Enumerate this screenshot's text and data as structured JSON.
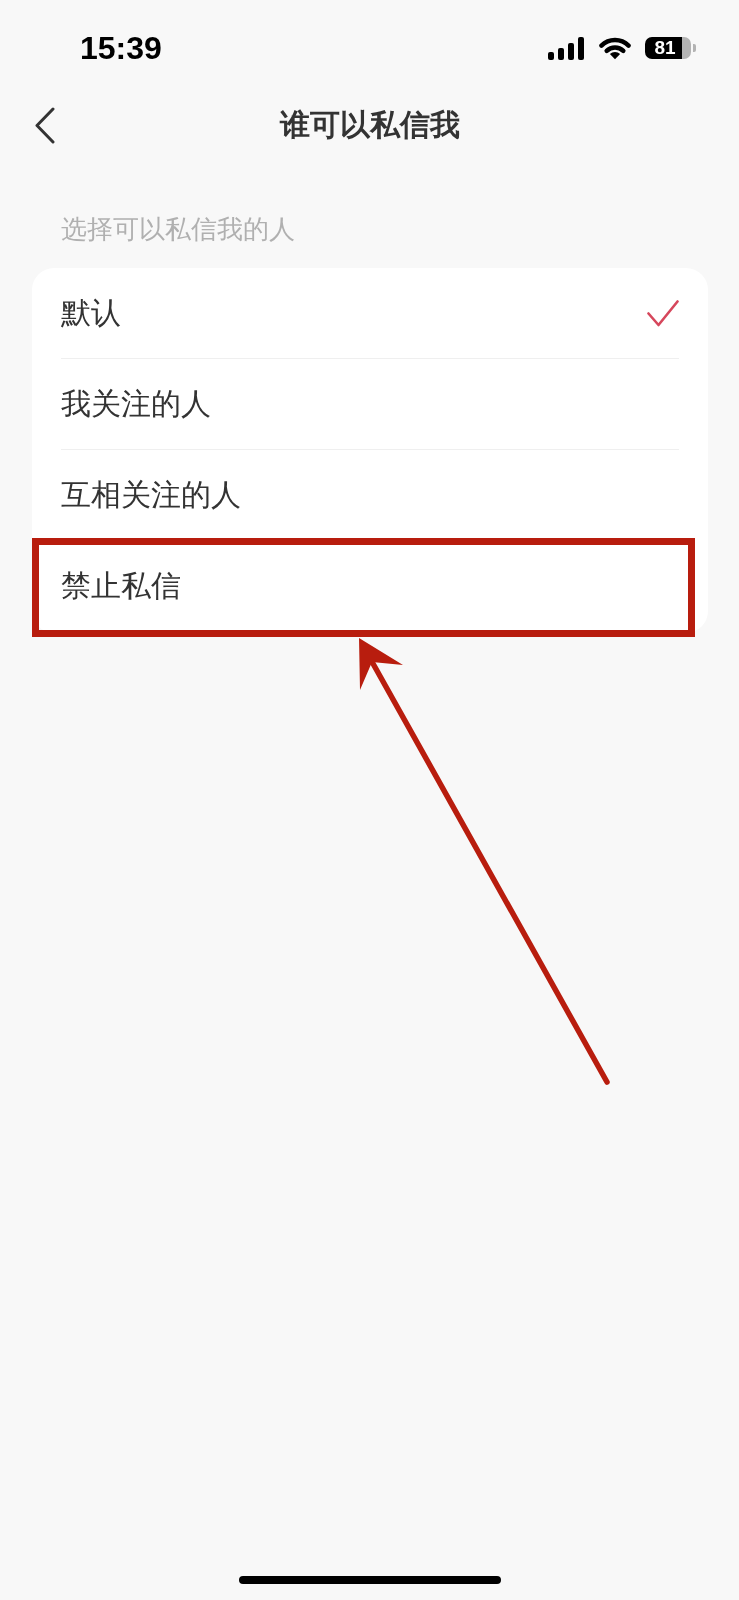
{
  "status_bar": {
    "time": "15:39",
    "battery": "81"
  },
  "header": {
    "title": "谁可以私信我"
  },
  "section": {
    "label": "选择可以私信我的人",
    "options": [
      {
        "label": "默认",
        "selected": true,
        "highlighted": false
      },
      {
        "label": "我关注的人",
        "selected": false,
        "highlighted": false
      },
      {
        "label": "互相关注的人",
        "selected": false,
        "highlighted": false
      },
      {
        "label": "禁止私信",
        "selected": false,
        "highlighted": true
      }
    ]
  }
}
